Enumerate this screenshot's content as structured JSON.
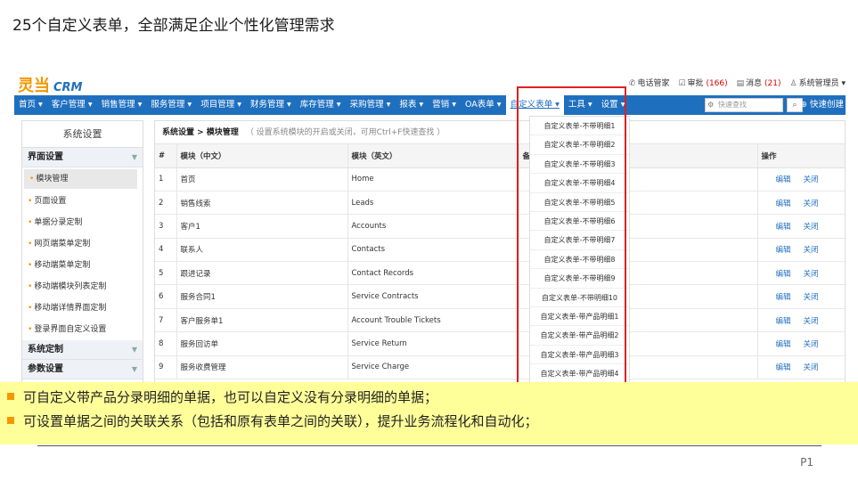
{
  "slide": {
    "title": "25个自定义表单，全部满足企业个性化管理需求",
    "page_number": "P1"
  },
  "app": {
    "logo_text": "灵当",
    "logo_crm": "CRM",
    "top_links": [
      {
        "icon": "phone-icon",
        "label": "电话管家",
        "count": ""
      },
      {
        "icon": "approval-icon",
        "label": "审批",
        "count": "(166)"
      },
      {
        "icon": "message-icon",
        "label": "消息",
        "count": "(21)"
      },
      {
        "icon": "user-icon",
        "label": "系统管理员 ▾",
        "count": ""
      }
    ],
    "nav": [
      "首页 ▾",
      "客户管理 ▾",
      "销售管理 ▾",
      "服务管理 ▾",
      "项目管理 ▾",
      "财务管理 ▾",
      "库存管理 ▾",
      "采购管理 ▾",
      "报表 ▾",
      "营销 ▾",
      "OA表单 ▾",
      "自定义表单 ▾",
      "工具 ▾",
      "设置 ▾"
    ],
    "search_placeholder": "快速查找",
    "quick_create": "⊕ 快速创建"
  },
  "sidebar": {
    "title": "系统设置",
    "groups": [
      {
        "label": "界面设置",
        "items": [
          "模块管理",
          "页面设置",
          "单据分录定制",
          "网页端菜单定制",
          "移动端菜单定制",
          "移动端模块列表定制",
          "移动端详情界面定制",
          "登录界面自定义设置"
        ]
      },
      {
        "label": "系统定制",
        "items": []
      },
      {
        "label": "参数设置",
        "items": []
      }
    ]
  },
  "main": {
    "breadcrumb": "系统设置 > 模块管理",
    "hint": "（ 设置系统模块的开启或关闭，可用Ctrl+F快速查找 ）",
    "columns": [
      "#",
      "模块（中文）",
      "模块（英文）",
      "备",
      "操作"
    ],
    "rows": [
      {
        "n": "1",
        "cn": "首页",
        "en": "Home"
      },
      {
        "n": "2",
        "cn": "销售线索",
        "en": "Leads"
      },
      {
        "n": "3",
        "cn": "客户1",
        "en": "Accounts"
      },
      {
        "n": "4",
        "cn": "联系人",
        "en": "Contacts"
      },
      {
        "n": "5",
        "cn": "跟进记录",
        "en": "Contact Records"
      },
      {
        "n": "6",
        "cn": "服务合同1",
        "en": "Service Contracts"
      },
      {
        "n": "7",
        "cn": "客户服务单1",
        "en": "Account Trouble Tickets"
      },
      {
        "n": "8",
        "cn": "服务回访单",
        "en": "Service Return"
      },
      {
        "n": "9",
        "cn": "服务收费管理",
        "en": "Service Charge"
      }
    ],
    "edit_label": "编辑",
    "close_label": "关闭"
  },
  "dropdown": [
    "自定义表单-不带明细1",
    "自定义表单-不带明细2",
    "自定义表单-不带明细3",
    "自定义表单-不带明细4",
    "自定义表单-不带明细5",
    "自定义表单-不带明细6",
    "自定义表单-不带明细7",
    "自定义表单-不带明细8",
    "自定义表单-不带明细9",
    "自定义表单-不带明细10",
    "自定义表单-带产品明细1",
    "自定义表单-带产品明细2",
    "自定义表单-带产品明细3",
    "自定义表单-带产品明细4"
  ],
  "notes": [
    "可自定义带产品分录明细的单据，也可以自定义没有分录明细的单据；",
    "可设置单据之间的关联关系（包括和原有表单之间的关联），提升业务流程化和自动化；"
  ],
  "colors": {
    "nav_blue": "#1f6fbf",
    "accent_orange": "#f39800",
    "highlight_red": "#e02020",
    "note_bg": "#ffff99"
  }
}
